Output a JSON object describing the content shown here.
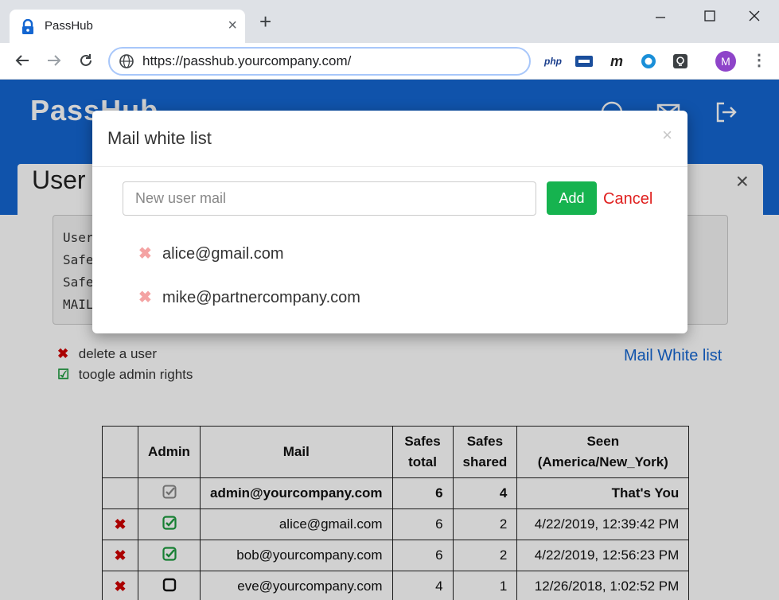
{
  "browser": {
    "tab_title": "PassHub",
    "tab_close": "×",
    "new_tab": "+",
    "url": "https://passhub.yourcompany.com/",
    "extensions": [
      "php-icon",
      "password-icon",
      "m-icon",
      "circle-icon",
      "lightbulb-icon"
    ],
    "ext_php": "php",
    "ext_m": "m",
    "avatar_letter": "M"
  },
  "header": {
    "logo": "PassHub"
  },
  "panel": {
    "title": "User",
    "close": "×",
    "info_lines": "User\nSafe\nSafe\nMAIL"
  },
  "legend": {
    "delete": {
      "symbol": "✖",
      "label": "delete a user",
      "color": "#d00000"
    },
    "toggle": {
      "symbol": "☑",
      "label": "toogle admin rights",
      "color": "#1c9c3e"
    }
  },
  "mail_white_list_link": "Mail White list",
  "users_table": {
    "headers": [
      "",
      "Admin",
      "Mail",
      "Safes total",
      "Safes shared",
      "Seen (America/New_York)"
    ],
    "header_admin": "Admin",
    "header_mail": "Mail",
    "header_safes_total_1": "Safes",
    "header_safes_total_2": "total",
    "header_safes_shared_1": "Safes",
    "header_safes_shared_2": "shared",
    "header_seen_1": "Seen",
    "header_seen_2": "(America/New_York)",
    "rows": [
      {
        "delete": "",
        "admin": "checked-grey",
        "mail": "admin@yourcompany.com",
        "total": "6",
        "shared": "4",
        "seen": "That's You",
        "bold": true
      },
      {
        "delete": "✖",
        "admin": "checked-green",
        "mail": "alice@gmail.com",
        "total": "6",
        "shared": "2",
        "seen": "4/22/2019, 12:39:42 PM"
      },
      {
        "delete": "✖",
        "admin": "checked-green",
        "mail": "bob@yourcompany.com",
        "total": "6",
        "shared": "2",
        "seen": "4/22/2019, 12:56:23 PM"
      },
      {
        "delete": "✖",
        "admin": "unchecked",
        "mail": "eve@yourcompany.com",
        "total": "4",
        "shared": "1",
        "seen": "12/26/2018, 1:02:52 PM"
      }
    ]
  },
  "modal": {
    "title": "Mail white list",
    "close": "×",
    "input_placeholder": "New user mail",
    "add_label": "Add",
    "cancel_label": "Cancel",
    "remove_symbol": "✖",
    "entries": [
      "alice@gmail.com",
      "mike@partnercompany.com"
    ]
  },
  "colors": {
    "brand_blue": "#1466d1",
    "add_green": "#16b34f",
    "cancel_red": "#e0201f"
  }
}
